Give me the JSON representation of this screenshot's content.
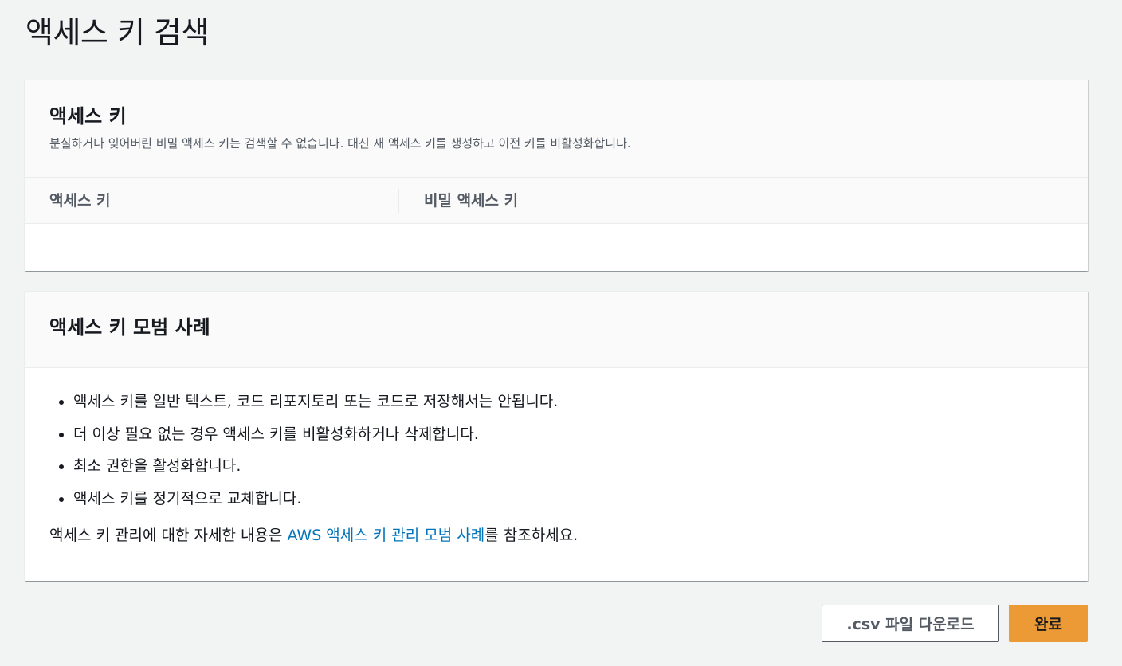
{
  "page": {
    "title": "액세스 키 검색"
  },
  "keys_panel": {
    "title": "액세스 키",
    "description": "분실하거나 잊어버린 비밀 액세스 키는 검색할 수 없습니다. 대신 새 액세스 키를 생성하고 이전 키를 비활성화합니다.",
    "columns": {
      "access_key": "액세스 키",
      "secret_key": "비밀 액세스 키"
    }
  },
  "best_practices": {
    "title": "액세스 키 모범 사례",
    "items": [
      "액세스 키를 일반 텍스트, 코드 리포지토리 또는 코드로 저장해서는 안됩니다.",
      "더 이상 필요 없는 경우 액세스 키를 비활성화하거나 삭제합니다.",
      "최소 권한을 활성화합니다.",
      "액세스 키를 정기적으로 교체합니다."
    ],
    "footnote_before": "액세스 키 관리에 대한 자세한 내용은 ",
    "footnote_link": "AWS 액세스 키 관리 모범 사례",
    "footnote_after": "를 참조하세요."
  },
  "actions": {
    "download_csv": ".csv 파일 다운로드",
    "done": "완료"
  },
  "colors": {
    "primary_button": "#ec9a36",
    "link": "#0073bb",
    "background": "#f2f3f3"
  }
}
